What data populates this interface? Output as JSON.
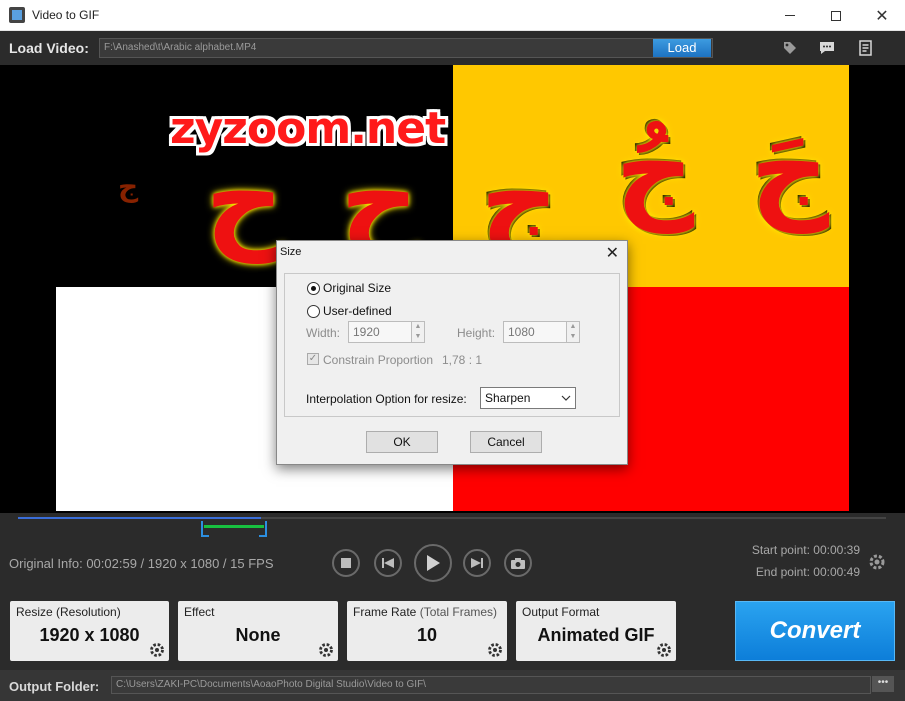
{
  "window": {
    "title": "Video to GIF"
  },
  "loadbar": {
    "label": "Load Video:",
    "path": "F:\\Anashed\\t\\Arabic alphabet.MP4",
    "load_button": "Load"
  },
  "video": {
    "watermark": "zyzoom.net",
    "glyphs": [
      "ج",
      "ح",
      "ح",
      "ج",
      "جُ",
      "جَ"
    ]
  },
  "info": {
    "original": "Original Info: 00:02:59 / 1920 x 1080 / 15 FPS",
    "start_point": "Start point: 00:00:39",
    "end_point": "End point: 00:00:49",
    "playhead_fraction": 0.28
  },
  "cards": [
    {
      "title": "Resize (Resolution)",
      "value": "1920 x 1080"
    },
    {
      "title": "Effect",
      "value": "None"
    },
    {
      "title": "Frame Rate",
      "title_sub": "(Total Frames)",
      "value": "10"
    },
    {
      "title": "Output Format",
      "value": "Animated GIF"
    }
  ],
  "convert_button": "Convert",
  "output": {
    "label": "Output Folder:",
    "path": "C:\\Users\\ZAKI-PC\\Documents\\AoaoPhoto Digital Studio\\Video to GIF\\",
    "more": "•••"
  },
  "dialog": {
    "title": "Size",
    "original_size": "Original Size",
    "user_defined": "User-defined",
    "width_label": "Width:",
    "width_value": "1920",
    "height_label": "Height:",
    "height_value": "1080",
    "constrain_label": "Constrain Proportion",
    "ratio": "1,78 : 1",
    "interp_label": "Interpolation Option for resize:",
    "interp_value": "Sharpen",
    "ok": "OK",
    "cancel": "Cancel"
  }
}
